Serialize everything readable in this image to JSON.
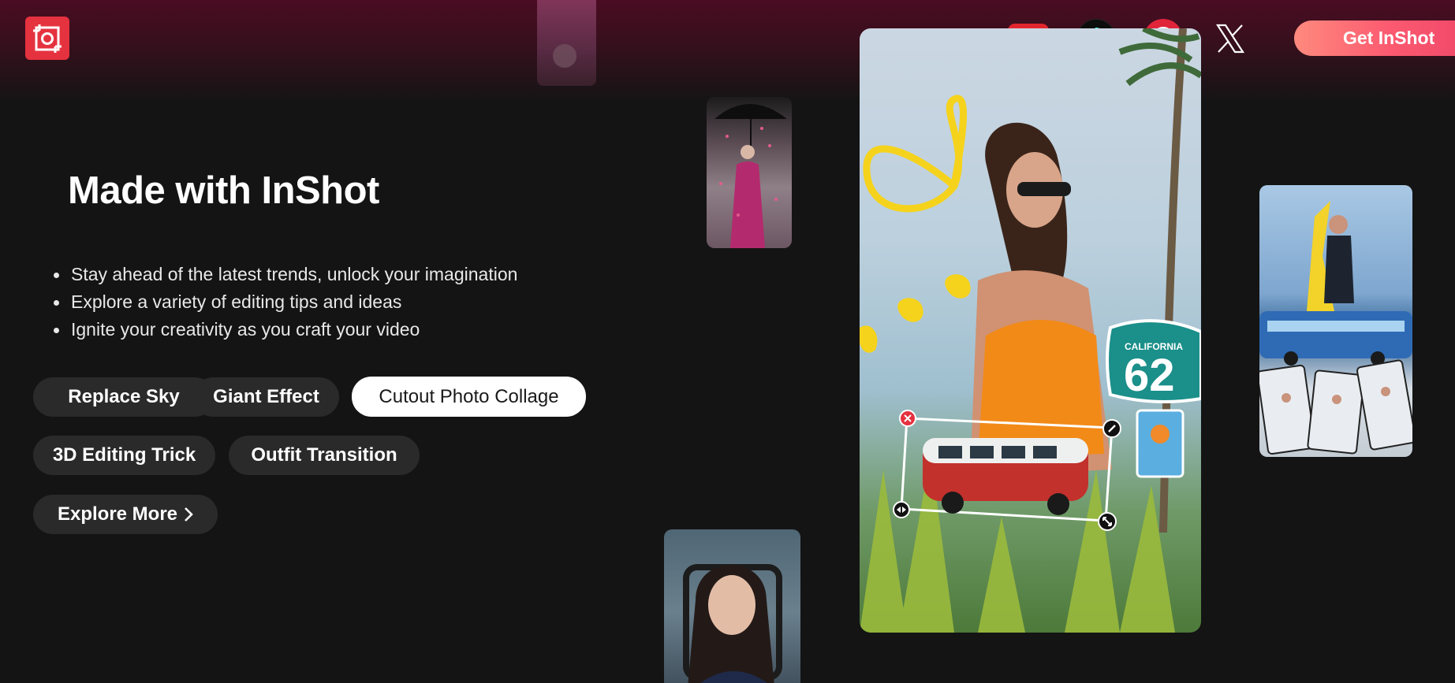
{
  "brand": {
    "logo_icon": "inshot-logo-icon",
    "accent_color": "#e5323f"
  },
  "header": {
    "social": [
      {
        "name": "youtube-icon",
        "color": "#e3262e"
      },
      {
        "name": "tiktok-icon",
        "color": "#0d0d0d"
      },
      {
        "name": "pinterest-icon",
        "color": "#e0243a"
      },
      {
        "name": "x-icon",
        "color": "#ffffff"
      }
    ],
    "cta_label": "Get InShot"
  },
  "hero": {
    "title": "Made with InShot",
    "bullets": [
      "Stay ahead of the latest trends, unlock your imagination",
      "Explore a variety of editing tips and ideas",
      "Ignite your creativity as you craft your video"
    ],
    "chips": [
      {
        "label": "Replace Sky",
        "active": false
      },
      {
        "label": "Giant Effect",
        "active": false
      },
      {
        "label": "Cutout Photo Collage",
        "active": true
      },
      {
        "label": "3D Editing Trick",
        "active": false
      },
      {
        "label": "Outfit Transition",
        "active": false
      }
    ],
    "explore_label": "Explore More"
  },
  "main_photo": {
    "sign_state": "CALIFORNIA",
    "sign_number": "62"
  }
}
